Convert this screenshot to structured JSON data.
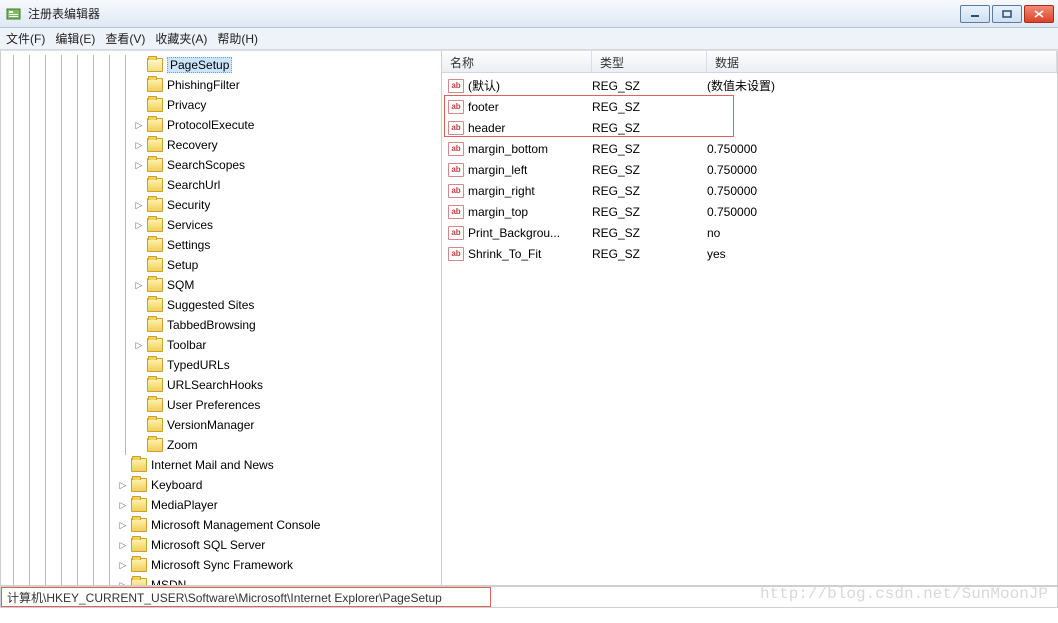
{
  "window": {
    "title": "注册表编辑器"
  },
  "menu": {
    "file": "文件(F)",
    "edit": "编辑(E)",
    "view": "查看(V)",
    "favorites": "收藏夹(A)",
    "help": "帮助(H)"
  },
  "tree": {
    "items": [
      {
        "depth": 8,
        "label": "PageSetup",
        "expander": "",
        "selected": true,
        "open": true
      },
      {
        "depth": 8,
        "label": "PhishingFilter",
        "expander": ""
      },
      {
        "depth": 8,
        "label": "Privacy",
        "expander": ""
      },
      {
        "depth": 8,
        "label": "ProtocolExecute",
        "expander": "▷"
      },
      {
        "depth": 8,
        "label": "Recovery",
        "expander": "▷"
      },
      {
        "depth": 8,
        "label": "SearchScopes",
        "expander": "▷"
      },
      {
        "depth": 8,
        "label": "SearchUrl",
        "expander": ""
      },
      {
        "depth": 8,
        "label": "Security",
        "expander": "▷"
      },
      {
        "depth": 8,
        "label": "Services",
        "expander": "▷"
      },
      {
        "depth": 8,
        "label": "Settings",
        "expander": ""
      },
      {
        "depth": 8,
        "label": "Setup",
        "expander": ""
      },
      {
        "depth": 8,
        "label": "SQM",
        "expander": "▷"
      },
      {
        "depth": 8,
        "label": "Suggested Sites",
        "expander": ""
      },
      {
        "depth": 8,
        "label": "TabbedBrowsing",
        "expander": ""
      },
      {
        "depth": 8,
        "label": "Toolbar",
        "expander": "▷"
      },
      {
        "depth": 8,
        "label": "TypedURLs",
        "expander": ""
      },
      {
        "depth": 8,
        "label": "URLSearchHooks",
        "expander": ""
      },
      {
        "depth": 8,
        "label": "User Preferences",
        "expander": ""
      },
      {
        "depth": 8,
        "label": "VersionManager",
        "expander": ""
      },
      {
        "depth": 8,
        "label": "Zoom",
        "expander": ""
      },
      {
        "depth": 7,
        "label": "Internet Mail and News",
        "expander": ""
      },
      {
        "depth": 7,
        "label": "Keyboard",
        "expander": "▷"
      },
      {
        "depth": 7,
        "label": "MediaPlayer",
        "expander": "▷"
      },
      {
        "depth": 7,
        "label": "Microsoft Management Console",
        "expander": "▷"
      },
      {
        "depth": 7,
        "label": "Microsoft SQL Server",
        "expander": "▷"
      },
      {
        "depth": 7,
        "label": "Microsoft Sync Framework",
        "expander": "▷"
      },
      {
        "depth": 7,
        "label": "MSDN",
        "expander": "▷"
      }
    ]
  },
  "list": {
    "columns": {
      "name": "名称",
      "type": "类型",
      "data": "数据"
    },
    "rows": [
      {
        "name": "(默认)",
        "type": "REG_SZ",
        "data": "(数值未设置)"
      },
      {
        "name": "footer",
        "type": "REG_SZ",
        "data": ""
      },
      {
        "name": "header",
        "type": "REG_SZ",
        "data": ""
      },
      {
        "name": "margin_bottom",
        "type": "REG_SZ",
        "data": "0.750000"
      },
      {
        "name": "margin_left",
        "type": "REG_SZ",
        "data": "0.750000"
      },
      {
        "name": "margin_right",
        "type": "REG_SZ",
        "data": "0.750000"
      },
      {
        "name": "margin_top",
        "type": "REG_SZ",
        "data": "0.750000"
      },
      {
        "name": "Print_Backgrou...",
        "type": "REG_SZ",
        "data": "no"
      },
      {
        "name": "Shrink_To_Fit",
        "type": "REG_SZ",
        "data": "yes"
      }
    ]
  },
  "statusbar": {
    "path": "计算机\\HKEY_CURRENT_USER\\Software\\Microsoft\\Internet Explorer\\PageSetup"
  },
  "watermark": "http://blog.csdn.net/SunMoonJP"
}
